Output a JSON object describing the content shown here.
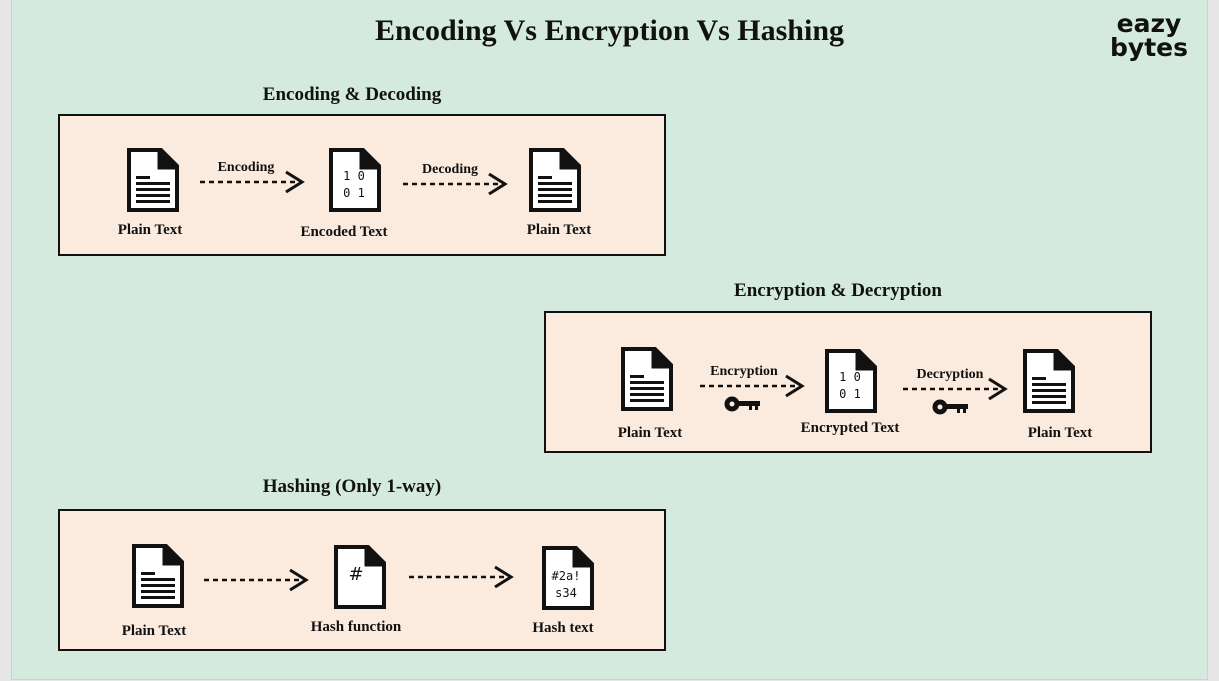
{
  "title": "Encoding Vs Encryption Vs Hashing",
  "logo": {
    "line1": "eazy",
    "line2": "bytes"
  },
  "encoding": {
    "title": "Encoding & Decoding",
    "nodes": [
      "Plain Text",
      "Encoded Text",
      "Plain Text"
    ],
    "arrows": [
      "Encoding",
      "Decoding"
    ],
    "binary": [
      "1 0",
      "0 1"
    ]
  },
  "encryption": {
    "title": "Encryption & Decryption",
    "nodes": [
      "Plain Text",
      "Encrypted Text",
      "Plain Text"
    ],
    "arrows": [
      "Encryption",
      "Decryption"
    ],
    "binary": [
      "1 0",
      "0 1"
    ]
  },
  "hashing": {
    "title": "Hashing (Only 1-way)",
    "nodes": [
      "Plain Text",
      "Hash function",
      "Hash text"
    ],
    "hash_symbol": "#",
    "hash_output": [
      "#2a!",
      "s34"
    ]
  },
  "icons": {
    "plain_doc": "document-lines-icon",
    "data_doc": "document-data-icon",
    "arrow": "dashed-arrow-icon",
    "key": "key-icon"
  }
}
